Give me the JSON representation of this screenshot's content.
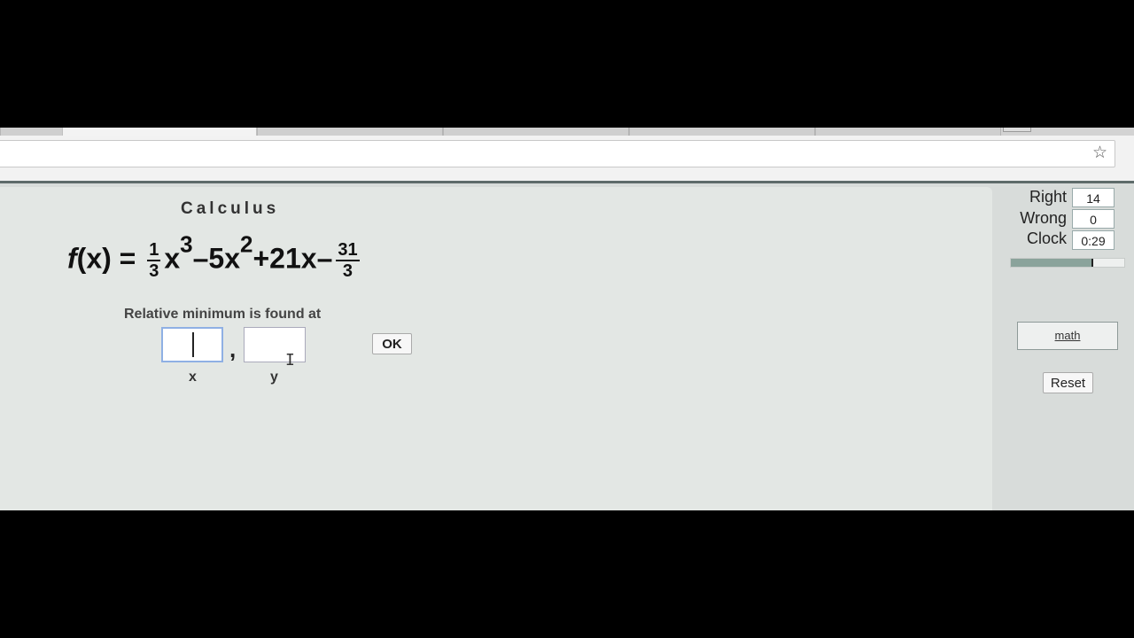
{
  "browser": {
    "star_icon": "☆"
  },
  "quiz": {
    "subject": "Calculus",
    "formula": {
      "fx": "f",
      "paren": "(x) = ",
      "frac1": {
        "num": "1",
        "den": "3"
      },
      "term1": "x",
      "exp1": "3",
      "term2": "–5x",
      "exp2": "2",
      "term3": "+21x–",
      "frac2": {
        "num": "31",
        "den": "3"
      }
    },
    "prompt": "Relative minimum is found at",
    "answer": {
      "x_value": "",
      "y_value": "",
      "separator": ",",
      "x_label": "x",
      "y_label": "y"
    },
    "ok_label": "OK"
  },
  "scoreboard": {
    "right_label": "Right",
    "right_value": "14",
    "wrong_label": "Wrong",
    "wrong_value": "0",
    "clock_label": "Clock",
    "clock_value": "0:29",
    "progress_fraction": 0.72
  },
  "sidebar": {
    "math_link": "math",
    "reset_label": "Reset"
  }
}
